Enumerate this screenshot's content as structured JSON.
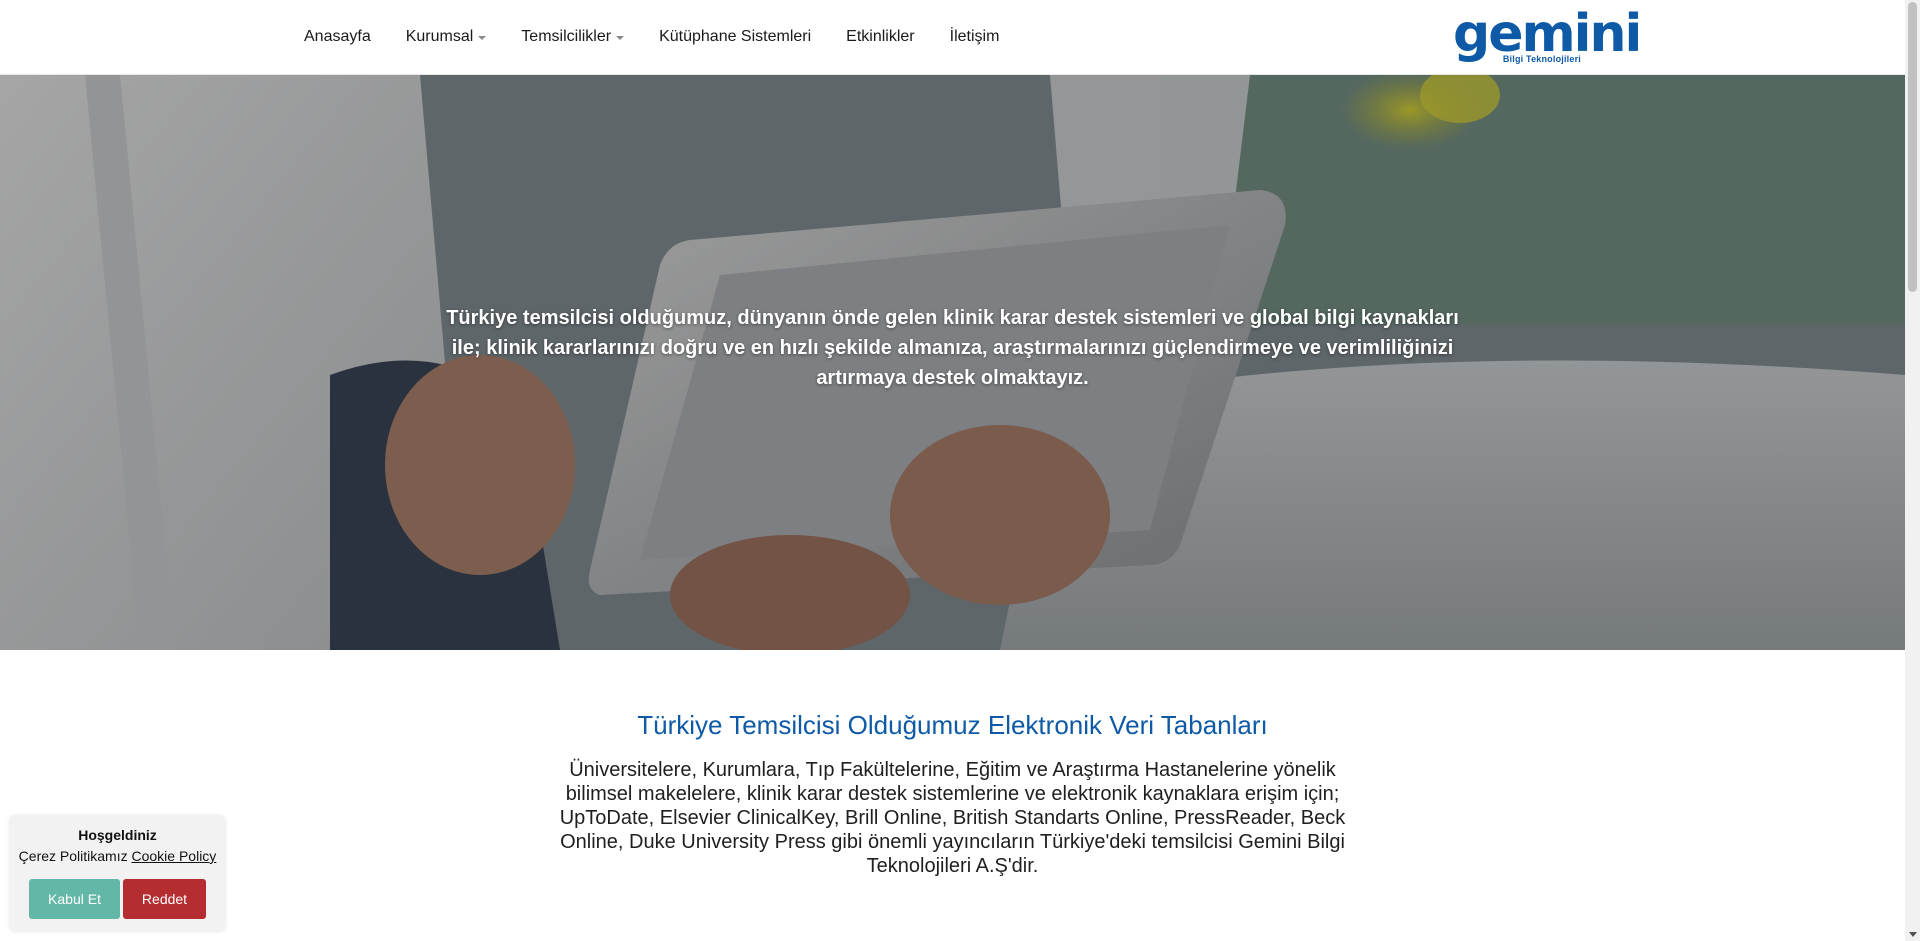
{
  "nav": {
    "items": [
      {
        "label": "Anasayfa",
        "dropdown": false
      },
      {
        "label": "Kurumsal",
        "dropdown": true
      },
      {
        "label": "Temsilcilikler",
        "dropdown": true
      },
      {
        "label": "Kütüphane Sistemleri",
        "dropdown": false
      },
      {
        "label": "Etkinlikler",
        "dropdown": false
      },
      {
        "label": "İletişim",
        "dropdown": false
      }
    ]
  },
  "logo": {
    "word": "gemini",
    "subtitle": "Bilgi Teknolojileri",
    "color": "#0e5aa7"
  },
  "hero": {
    "text": "Türkiye temsilcisi olduğumuz, dünyanın önde gelen klinik karar destek sistemleri ve global bilgi kaynakları ile; klinik kararlarınızı doğru ve en hızlı şekilde almanıza, araştırmalarınızı güçlendirmeye ve verimliliğinizi artırmaya destek olmaktayız."
  },
  "section": {
    "title": "Türkiye Temsilcisi Olduğumuz Elektronik Veri Tabanları",
    "description": "Üniversitelere, Kurumlara, Tıp Fakültelerine, Eğitim ve Araştırma Hastanelerine yönelik bilimsel makelelere, klinik karar destek sistemlerine ve elektronik kaynaklara erişim için; UpToDate, Elsevier ClinicalKey, Brill Online, British Standarts Online, PressReader, Beck Online, Duke University Press gibi önemli yayıncıların Türkiye'deki temsilcisi Gemini Bilgi Teknolojileri A.Ş'dir."
  },
  "cookie": {
    "title": "Hoşgeldiniz",
    "text": "Çerez Politikamız",
    "link": "Cookie Policy",
    "accept": "Kabul Et",
    "reject": "Reddet"
  },
  "colors": {
    "accent": "#0e5aa7",
    "accept_button": "#63b7a6",
    "reject_button": "#b52d30"
  }
}
